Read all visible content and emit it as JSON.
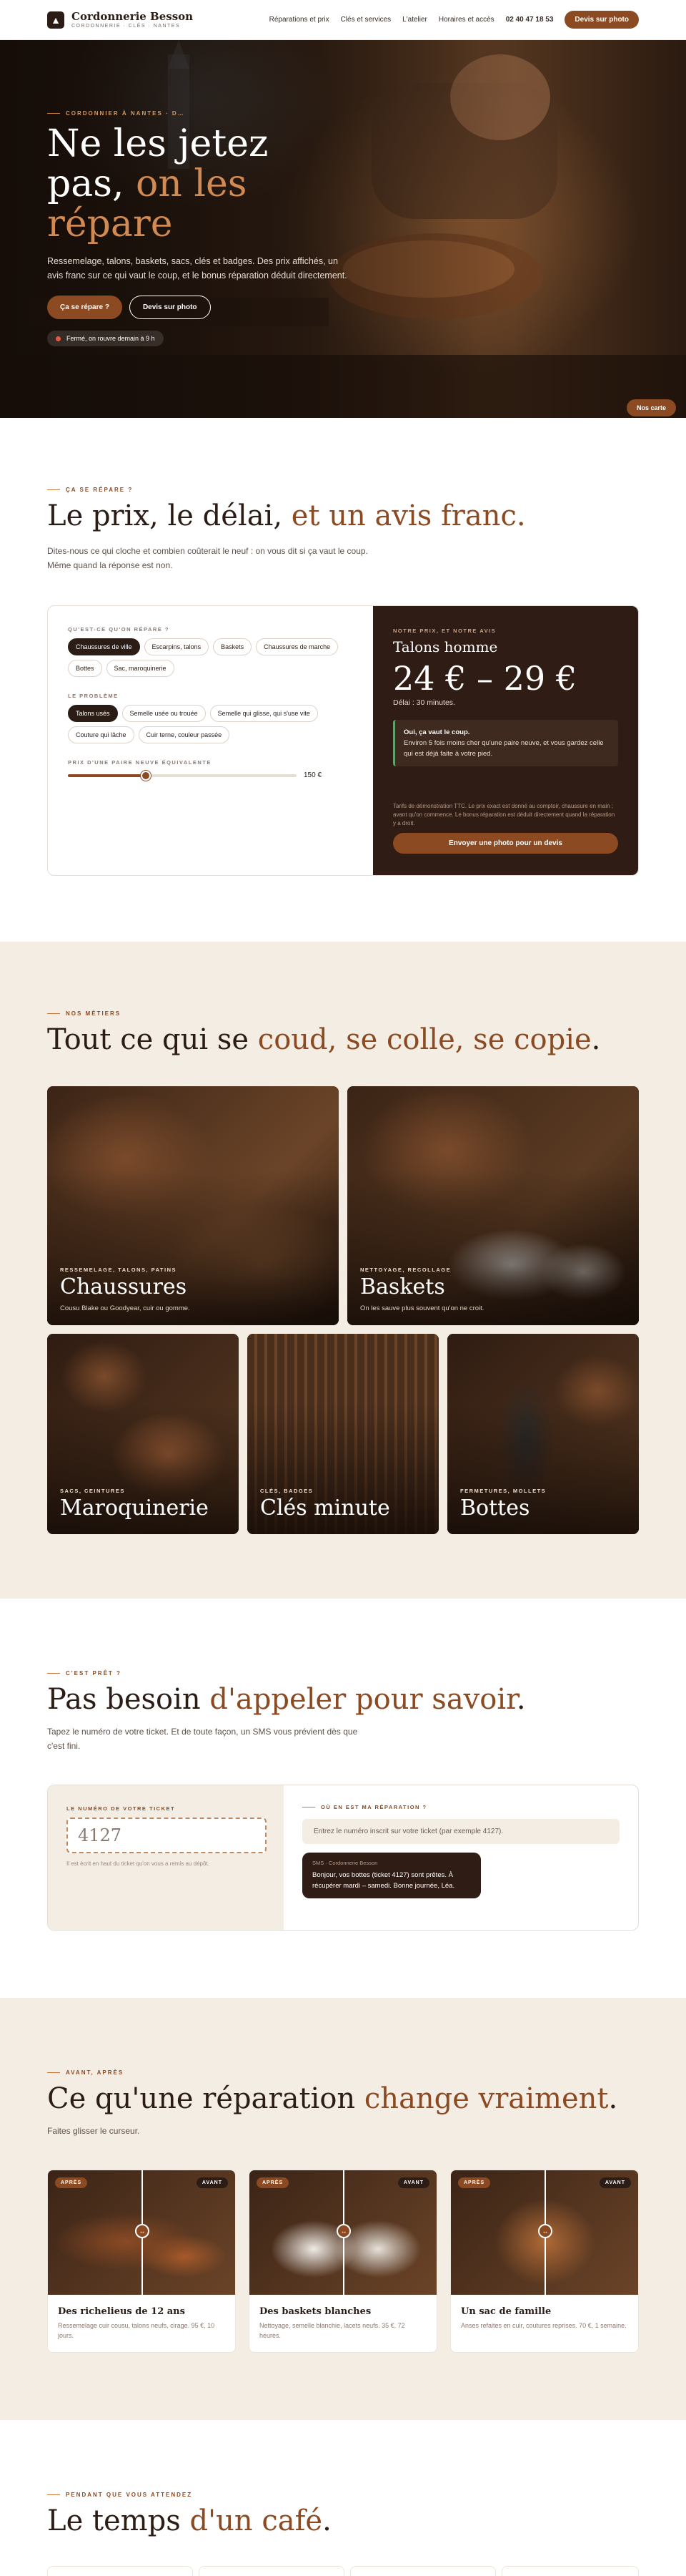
{
  "header": {
    "brand_name": "Cordonnerie Besson",
    "brand_sub": "CORDONNERIE · CLÉS · NANTES",
    "nav": [
      "Réparations et prix",
      "Clés et services",
      "L'atelier",
      "Horaires et accès"
    ],
    "phone": "02 40 47 18 53",
    "cta": "Devis sur photo"
  },
  "hero": {
    "kicker": "CORDONNIER À NANTES · D…",
    "title_l1": "Ne les jetez",
    "title_l2a": "pas, ",
    "title_l2b": "on les",
    "title_l3": "répare",
    "text": "Ressemelage, talons, baskets, sacs, clés et badges. Des prix affichés, un avis franc sur ce qui vaut le coup, et le bonus réparation déduit directement.",
    "btn_primary": "Ça se répare ?",
    "btn_secondary": "Devis sur photo",
    "status": "Fermé, on rouvre demain à 9 h",
    "map_button": "Nos carte"
  },
  "pricing": {
    "kicker": "ÇA SE RÉPARE ?",
    "title_a": "Le prix, le délai, ",
    "title_b": "et un avis franc.",
    "lead": "Dites-nous ce qui cloche et combien coûterait le neuf : on vous dit si ça vaut le coup. Même quand la réponse est non.",
    "q_object": "QU'EST-CE QU'ON RÉPARE ?",
    "objects": [
      "Chaussures de ville",
      "Escarpins, talons",
      "Baskets",
      "Chaussures de marche",
      "Bottes",
      "Sac, maroquinerie"
    ],
    "q_problem": "LE PROBLÈME",
    "problems": [
      "Talons usés",
      "Semelle usée ou trouée",
      "Semelle qui glisse, qui s'use vite",
      "Couture qui lâche",
      "Cuir terne, couleur passée"
    ],
    "q_price": "PRIX D'UNE PAIRE NEUVE ÉQUIVALENTE",
    "price_value": "150 €",
    "price_level": 0.34,
    "result_kicker": "NOTRE PRIX, ET NOTRE AVIS",
    "result_name": "Talons homme",
    "result_price": "24 € – 29 €",
    "result_delay": "Délai : 30 minutes.",
    "verdict_title": "Oui, ça vaut le coup.",
    "verdict_text": "Environ 5 fois moins cher qu'une paire neuve, et vous gardez celle qui est déjà faite à votre pied.",
    "note": "Tarifs de démonstration TTC. Le prix exact est donné au comptoir, chaussure en main ; avant qu'on commence. Le bonus réparation est déduit directement quand la réparation y a droit.",
    "result_btn": "Envoyer une photo pour un devis"
  },
  "metiers": {
    "kicker": "NOS MÉTIERS",
    "title_a": "Tout ce qui se ",
    "title_b": "coud, se colle, se copie",
    "title_c": ".",
    "cards": [
      {
        "kicker": "RESSEMELAGE, TALONS, PATINS",
        "title": "Chaussures",
        "desc": "Cousu Blake ou Goodyear, cuir ou gomme."
      },
      {
        "kicker": "NETTOYAGE, RECOLLAGE",
        "title": "Baskets",
        "desc": "On les sauve plus souvent qu'on ne croit."
      },
      {
        "kicker": "SACS, CEINTURES",
        "title": "Maroquinerie",
        "desc": ""
      },
      {
        "kicker": "CLÉS, BADGES",
        "title": "Clés minute",
        "desc": ""
      },
      {
        "kicker": "FERMETURES, MOLLETS",
        "title": "Bottes",
        "desc": ""
      }
    ]
  },
  "ticket": {
    "kicker": "C'EST PRÊT ?",
    "title_a": "Pas besoin ",
    "title_b": "d'appeler pour savoir",
    "title_c": ".",
    "lead": "Tapez le numéro de votre ticket. Et de toute façon, un SMS vous prévient dès que c'est fini.",
    "label": "LE NUMÉRO DE VOTRE TICKET",
    "placeholder": "4127",
    "hint": "Il est écrit en haut du ticket qu'on vous a remis au dépôt.",
    "question": "OÙ EN EST MA RÉPARATION ?",
    "info": "Entrez le numéro inscrit sur votre ticket (par exemple 4127).",
    "sms_from": "SMS · Cordonnerie Besson",
    "sms_text": "Bonjour, vos bottes (ticket 4127) sont prêtes. À récupérer mardi – samedi. Bonne journée, Léa."
  },
  "before_after": {
    "kicker": "AVANT, APRÈS",
    "title_a": "Ce qu'une réparation ",
    "title_b": "change vraiment",
    "title_c": ".",
    "lead": "Faites glisser le curseur.",
    "before": "APRÈS",
    "after": "AVANT",
    "items": [
      {
        "title": "Des richelieus de 12 ans",
        "desc": "Ressemelage cuir cousu, talons neufs, cirage. 95 €, 10 jours."
      },
      {
        "title": "Des baskets blanches",
        "desc": "Nettoyage, semelle blanchie, lacets neufs. 35 €, 72 heures."
      },
      {
        "title": "Un sac de famille",
        "desc": "Anses refaites en cuir, coutures reprises. 70 €, 1 semaine."
      }
    ]
  },
  "wait": {
    "kicker": "PENDANT QUE VOUS ATTENDEZ",
    "title_a": "Le temps ",
    "title_b": "d'un café",
    "title_c": "."
  }
}
